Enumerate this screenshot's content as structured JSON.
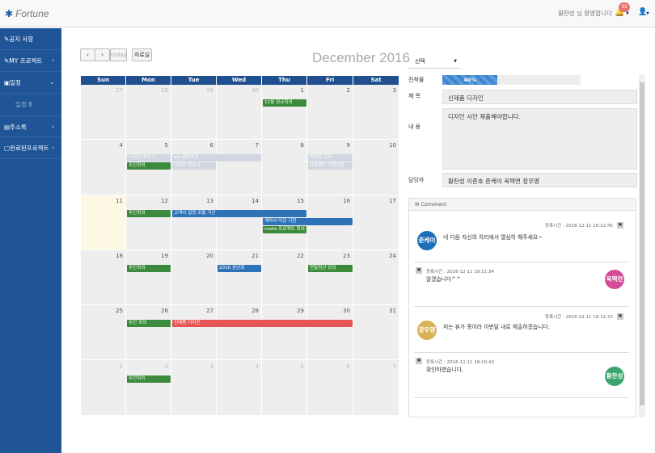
{
  "topbar": {
    "brand": "Fortune",
    "welcome": "황찬성 님 환영합니다",
    "notifications": "31"
  },
  "sidebar": {
    "items": [
      {
        "label": "공지 사항",
        "chevron": ""
      },
      {
        "label": "MY 프로젝트",
        "chevron": "‹"
      },
      {
        "label": "일정",
        "chevron": "⌄"
      },
      {
        "label": "일정 8",
        "chevron": ""
      },
      {
        "label": "주소록",
        "chevron": "‹"
      },
      {
        "label": "완료된프로젝트",
        "chevron": "‹"
      }
    ]
  },
  "calendar": {
    "title": "December 2016",
    "prev": "‹",
    "next": "›",
    "today": "today",
    "room": "자료실",
    "days": [
      "Sun",
      "Mon",
      "Tue",
      "Wed",
      "Thu",
      "Fri",
      "Sat"
    ],
    "weeks": [
      [
        "27",
        "28",
        "29",
        "30",
        "1",
        "2",
        "3"
      ],
      [
        "4",
        "5",
        "6",
        "7",
        "8",
        "9",
        "10"
      ],
      [
        "11",
        "12",
        "13",
        "14",
        "15",
        "16",
        "17"
      ],
      [
        "18",
        "19",
        "20",
        "21",
        "22",
        "23",
        "24"
      ],
      [
        "25",
        "26",
        "27",
        "28",
        "29",
        "30",
        "31"
      ],
      [
        "1",
        "2",
        "3",
        "4",
        "5",
        "6",
        "7"
      ]
    ],
    "events": [
      {
        "label": "12월 정규회의",
        "color": "green"
      },
      {
        "label": "디자인 회의 1",
        "color": "light"
      },
      {
        "label": "주간회의",
        "color": "green"
      },
      {
        "label": "a/s 센터추진",
        "color": "light"
      },
      {
        "label": "디자인 점검 2",
        "color": "light"
      },
      {
        "label": "마감일 준비",
        "color": "light"
      },
      {
        "label": "프로젝트 진행현황",
        "color": "light"
      },
      {
        "label": "주간회의",
        "color": "green"
      },
      {
        "label": "고객사 일정 조율 기간",
        "color": "blue"
      },
      {
        "label": "계약서 마감 기한",
        "color": "blue"
      },
      {
        "label": "noste 프로젝트 회의",
        "color": "green"
      },
      {
        "label": "주간회의",
        "color": "green"
      },
      {
        "label": "2016 송년회",
        "color": "blue"
      },
      {
        "label": "연말정산 강의",
        "color": "green"
      },
      {
        "label": "주간 회의",
        "color": "green"
      },
      {
        "label": "신제품 디자인",
        "color": "red"
      },
      {
        "label": "주간회의",
        "color": "green"
      }
    ]
  },
  "detail": {
    "select": "선택",
    "progress_label": "진척률",
    "progress_value": "40%",
    "progress": 0.4,
    "title_label": "제 목",
    "title_value": "신제품 디자인",
    "content_label": "내 용",
    "content_value": "디자인 시안 제출해야합니다.",
    "owner_label": "담당자",
    "owner_value": "황찬성 이준호 준케이 옥택연 장우영"
  },
  "comments": {
    "header": "Comment",
    "items": [
      {
        "avatar": "준케이",
        "time": "등록시간 : 2016-12-11 18:12:45",
        "text": "네 다음 자신의 차리에서 열심히 해주세요~"
      },
      {
        "avatar": "옥택연",
        "time": "등록시간 : 2016-12-11 18:11:34",
        "text": "알겠습니다^^"
      },
      {
        "avatar": "장우영",
        "time": "등록시간 : 2016-12-11 18:11:32",
        "text": "저는 휴가 중이라 이번달 내로 제출하겠습니다."
      },
      {
        "avatar": "황찬성",
        "time": "등록시간 : 2016-12-11 18:10:42",
        "text": "확인하였습니다."
      }
    ]
  },
  "colors": {
    "primary": "#1f5596",
    "header": "#1f4f8f",
    "green": "#3c8a3c",
    "blue": "#2e72b8",
    "red": "#e55555",
    "light": "#d0d7e0",
    "today": "#fcf8e3"
  }
}
